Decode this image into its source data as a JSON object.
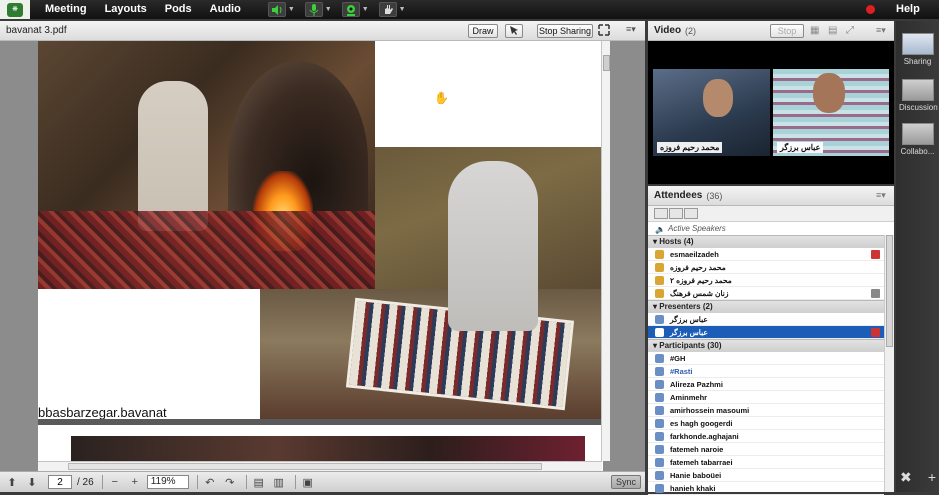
{
  "topbar": {
    "menus": [
      "Meeting",
      "Layouts",
      "Pods",
      "Audio"
    ],
    "help_label": "Help",
    "icons": [
      "speaker-icon",
      "microphone-icon",
      "webcam-icon",
      "raise-hand-icon"
    ],
    "accent_green": "#3ad13a",
    "record_color": "#e02020"
  },
  "share": {
    "title": "bavanat 3.pdf",
    "draw_label": "Draw",
    "stop_sharing_label": "Stop Sharing",
    "caption": "bbasbarzegar.bavanat",
    "page_current": "2",
    "page_total": "/ 26",
    "zoom": "119%",
    "sync_label": "Sync"
  },
  "video": {
    "title": "Video",
    "count": "(2)",
    "stop_label": "Stop",
    "feeds": [
      {
        "name": "محمد رحیم فروزه"
      },
      {
        "name": "عباس برزگر"
      }
    ]
  },
  "attendees": {
    "title": "Attendees",
    "count": "(36)",
    "active_speakers": "Active Speakers",
    "hosts_header": "Hosts (4)",
    "hosts": [
      "esmaeilzadeh",
      "محمد رحیم فروزه",
      "محمد رحیم فروزه ۲",
      "زنان شمس فرهنگ"
    ],
    "presenters_header": "Presenters (2)",
    "presenters": [
      "عباس برزگر",
      "عباس برزگر"
    ],
    "participants_header": "Participants (30)",
    "participants": [
      "#GH",
      "#Rasti",
      "Alireza Pazhmi",
      "Aminmehr",
      "amirhossein masoumi",
      "es hagh googerdi",
      "farkhonde.aghajani",
      "fatemeh naroie",
      "fatemeh tabarraei",
      "Hanie baboüei",
      "hanieh khaki"
    ]
  },
  "rail": {
    "items": [
      "Sharing",
      "Discussion",
      "Collabo..."
    ]
  }
}
